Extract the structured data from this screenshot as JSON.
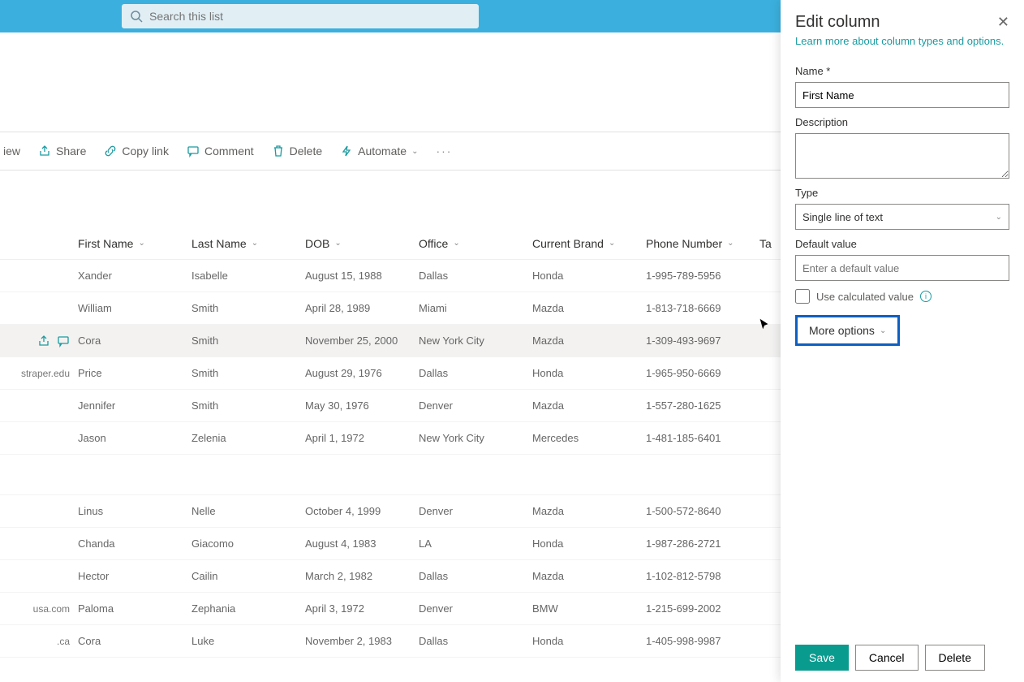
{
  "search": {
    "placeholder": "Search this list"
  },
  "cmdbar": {
    "view": "iew",
    "share": "Share",
    "copy_link": "Copy link",
    "comment": "Comment",
    "delete": "Delete",
    "automate": "Automate"
  },
  "columns": {
    "first_name": "First Name",
    "last_name": "Last Name",
    "dob": "DOB",
    "office": "Office",
    "current_brand": "Current Brand",
    "phone_number": "Phone Number",
    "extra": "Ta"
  },
  "rows": [
    {
      "lead": "",
      "first": "Xander",
      "last": "Isabelle",
      "dob": "August 15, 1988",
      "office": "Dallas",
      "brand": "Honda",
      "phone": "1-995-789-5956"
    },
    {
      "lead": "",
      "first": "William",
      "last": "Smith",
      "dob": "April 28, 1989",
      "office": "Miami",
      "brand": "Mazda",
      "phone": "1-813-718-6669"
    },
    {
      "lead": "",
      "first": "Cora",
      "last": "Smith",
      "dob": "November 25, 2000",
      "office": "New York City",
      "brand": "Mazda",
      "phone": "1-309-493-9697",
      "selected": true
    },
    {
      "lead": "straper.edu",
      "first": "Price",
      "last": "Smith",
      "dob": "August 29, 1976",
      "office": "Dallas",
      "brand": "Honda",
      "phone": "1-965-950-6669"
    },
    {
      "lead": "",
      "first": "Jennifer",
      "last": "Smith",
      "dob": "May 30, 1976",
      "office": "Denver",
      "brand": "Mazda",
      "phone": "1-557-280-1625"
    },
    {
      "lead": "",
      "first": "Jason",
      "last": "Zelenia",
      "dob": "April 1, 1972",
      "office": "New York City",
      "brand": "Mercedes",
      "phone": "1-481-185-6401"
    },
    {
      "gap": true
    },
    {
      "lead": "",
      "first": "Linus",
      "last": "Nelle",
      "dob": "October 4, 1999",
      "office": "Denver",
      "brand": "Mazda",
      "phone": "1-500-572-8640"
    },
    {
      "lead": "",
      "first": "Chanda",
      "last": "Giacomo",
      "dob": "August 4, 1983",
      "office": "LA",
      "brand": "Honda",
      "phone": "1-987-286-2721"
    },
    {
      "lead": "",
      "first": "Hector",
      "last": "Cailin",
      "dob": "March 2, 1982",
      "office": "Dallas",
      "brand": "Mazda",
      "phone": "1-102-812-5798"
    },
    {
      "lead": "usa.com",
      "first": "Paloma",
      "last": "Zephania",
      "dob": "April 3, 1972",
      "office": "Denver",
      "brand": "BMW",
      "phone": "1-215-699-2002"
    },
    {
      "lead": ".ca",
      "first": "Cora",
      "last": "Luke",
      "dob": "November 2, 1983",
      "office": "Dallas",
      "brand": "Honda",
      "phone": "1-405-998-9987"
    }
  ],
  "panel": {
    "title": "Edit column",
    "learn_link": "Learn more about column types and options.",
    "name_label": "Name *",
    "name_value": "First Name",
    "description_label": "Description",
    "type_label": "Type",
    "type_value": "Single line of text",
    "default_label": "Default value",
    "default_placeholder": "Enter a default value",
    "calc_label": "Use calculated value",
    "more_options": "More options",
    "save": "Save",
    "cancel": "Cancel",
    "delete": "Delete"
  }
}
